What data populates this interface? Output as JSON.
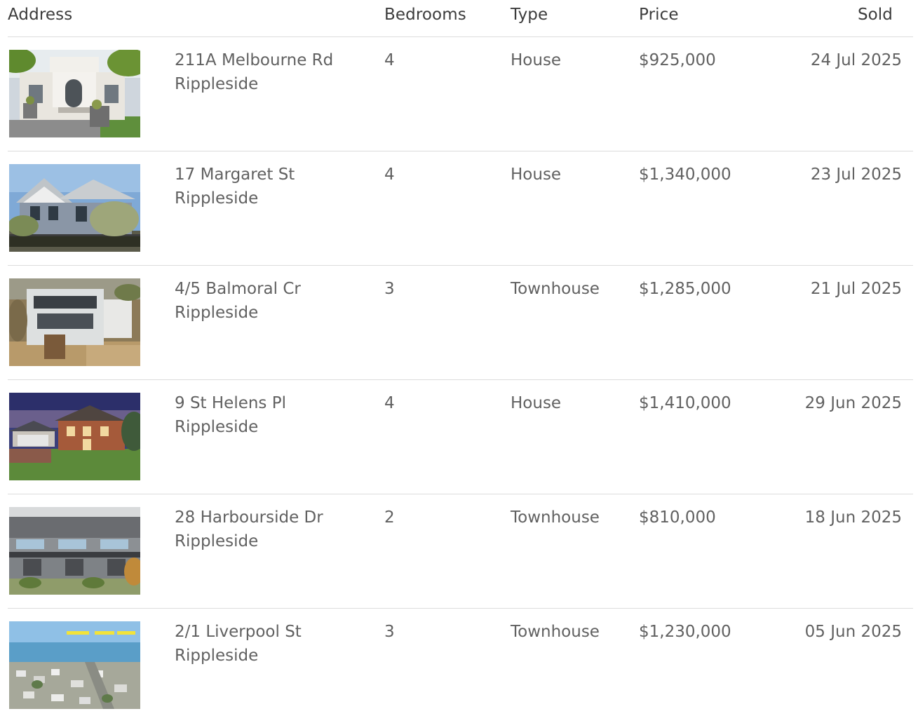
{
  "columns": {
    "address": "Address",
    "bedrooms": "Bedrooms",
    "type": "Type",
    "price": "Price",
    "sold": "Sold"
  },
  "rows": [
    {
      "street": "211A Melbourne Rd",
      "suburb": "Rippleside",
      "bedrooms": "4",
      "type": "House",
      "price": "$925,000",
      "sold": "24 Jul 2025",
      "photo": "house-photo"
    },
    {
      "street": "17 Margaret St",
      "suburb": "Rippleside",
      "bedrooms": "4",
      "type": "House",
      "price": "$1,340,000",
      "sold": "23 Jul 2025",
      "photo": "house-photo"
    },
    {
      "street": "4/5 Balmoral Cr",
      "suburb": "Rippleside",
      "bedrooms": "3",
      "type": "Townhouse",
      "price": "$1,285,000",
      "sold": "21 Jul 2025",
      "photo": "house-photo"
    },
    {
      "street": "9 St Helens Pl",
      "suburb": "Rippleside",
      "bedrooms": "4",
      "type": "House",
      "price": "$1,410,000",
      "sold": "29 Jun 2025",
      "photo": "house-photo"
    },
    {
      "street": "28 Harbourside Dr",
      "suburb": "Rippleside",
      "bedrooms": "2",
      "type": "Townhouse",
      "price": "$810,000",
      "sold": "18 Jun 2025",
      "photo": "house-photo"
    },
    {
      "street": "2/1 Liverpool St",
      "suburb": "Rippleside",
      "bedrooms": "3",
      "type": "Townhouse",
      "price": "$1,230,000",
      "sold": "05 Jun 2025",
      "photo": "aerial-photo"
    }
  ]
}
